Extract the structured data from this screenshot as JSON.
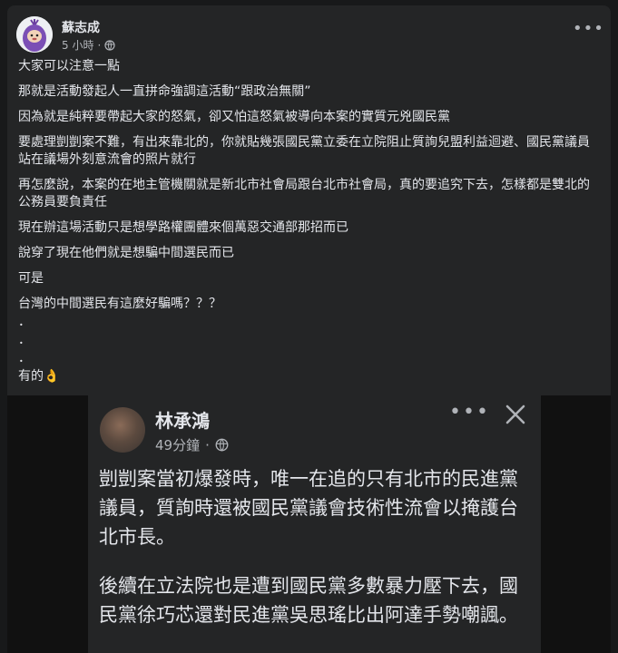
{
  "post": {
    "author": "蘇志成",
    "time": "5 小時",
    "dot": "·",
    "more_icon": "more-dots-icon",
    "lines": [
      "大家可以注意一點",
      "那就是活動發起人一直拼命強調這活動“跟政治無關”",
      "因為就是純粹要帶起大家的怒氣，卻又怕這怒氣被導向本案的實質元兇國民黨",
      "要處理剴剴案不難，有出來靠北的，你就貼幾張國民黨立委在立院阻止質詢兒盟利益迴避、國民黨議員站在議場外刻意流會的照片就行",
      "再怎麼說，本案的在地主管機關就是新北市社會局跟台北市社會局，真的要追究下去，怎樣都是雙北的公務員要負責任",
      "現在辦這場活動只是想學路權團體來個萬惡交通部那招而已",
      "說穿了現在他們就是想騙中間選民而已",
      "可是",
      "台灣的中間選民有這麼好騙嗎？？？",
      "．",
      "．",
      "．",
      "有的"
    ],
    "emoji": "👌"
  },
  "screenshot": {
    "author": "林承鴻",
    "time": "49分鐘",
    "dot": "·",
    "paragraphs": [
      "剴剴案當初爆發時，唯一在追的只有北市的民進黨議員，質詢時還被國民黨議會技術性流會以掩護台北市長。",
      "後續在立法院也是遭到國民黨多數暴力壓下去，國民黨徐巧芯還對民進黨吳思瑤比出阿達手勢嘲諷。"
    ]
  }
}
